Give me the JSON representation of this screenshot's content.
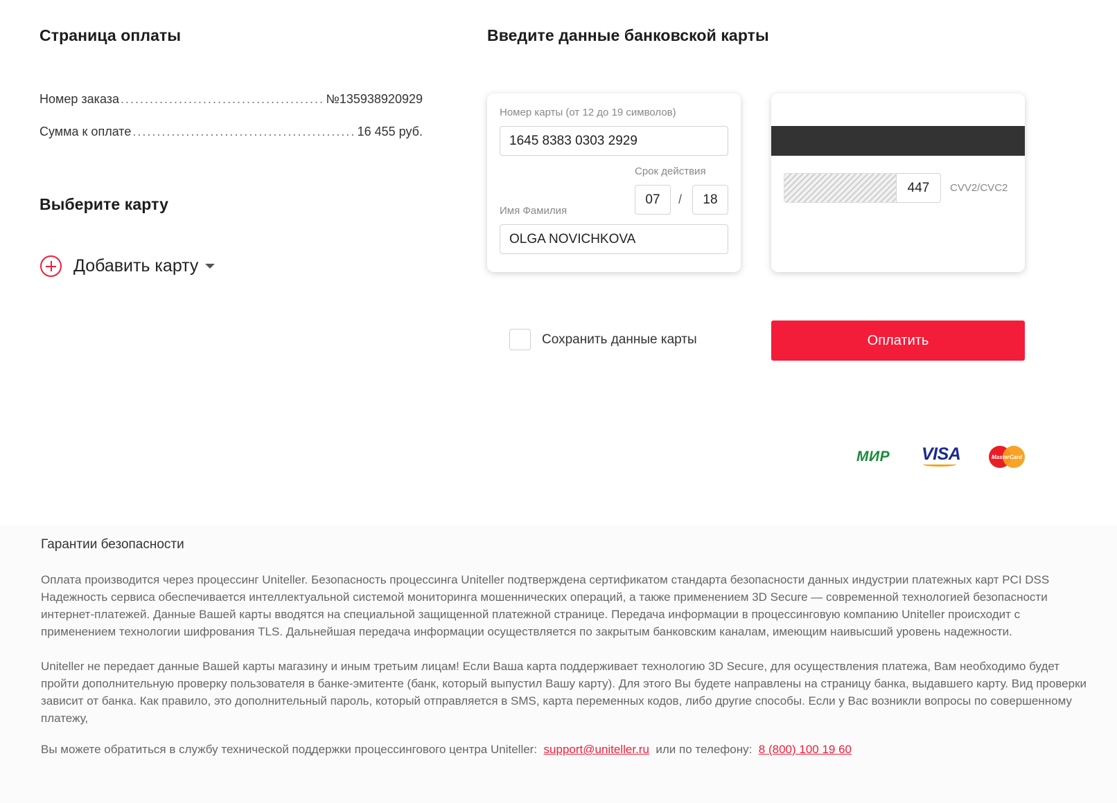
{
  "page_title": "Страница оплаты",
  "card_section_title": "Введите данные банковской карты",
  "order": {
    "number_label": "Номер заказа",
    "number_value": "№135938920929",
    "sum_label": "Сумма к оплате",
    "sum_value": "16 455 руб."
  },
  "choose_card_title": "Выберите карту",
  "add_card_label": "Добавить карту",
  "card_form": {
    "number_label": "Номер карты (от 12 до 19 символов)",
    "number_value": "1645 8383 0303 2929",
    "expiry_label": "Срок действия",
    "expiry_month": "07",
    "expiry_separator": "/",
    "expiry_year": "18",
    "name_label": "Имя Фамилия",
    "name_value": "OLGA NOVICHKOVA",
    "cvv_value": "447",
    "cvv_label": "CVV2/CVC2"
  },
  "save_card_label": "Сохранить данные карты",
  "pay_button_label": "Оплатить",
  "logos": {
    "mir": "МИР",
    "visa": "VISA",
    "mastercard": "MasterCard"
  },
  "security": {
    "title": "Гарантии безопасности",
    "paragraph1": "Оплата производится через процессинг Uniteller. Безопасность процессинга Uniteller подтверждена сертификатом стандарта безопасности данных индустрии платежных карт PCI DSS Надежность сервиса обеспечивается интеллектуальной системой мониторинга мошеннических операций, а также применением 3D Secure — современной технологией безопасности интернет-платежей. Данные Вашей карты вводятся на специальной защищенной платежной странице. Передача информации в процессинговую компанию Uniteller происходит с применением технологии шифрования TLS. Дальнейшая передача информации осуществляется по закрытым банковским каналам, имеющим наивысший уровень надежности.",
    "paragraph2": "Uniteller не передает данные Вашей карты магазину и иным третьим лицам! Если Ваша карта поддерживает технологию 3D Secure, для осуществления платежа, Вам необходимо будет пройти дополнительную проверку пользователя в банке-эмитенте (банк, который выпустил Вашу карту). Для этого Вы будете направлены на страницу банка, выдавшего карту. Вид проверки зависит от банка. Как правило, это дополнительный пароль, который отправляется в SMS, карта переменных кодов, либо другие способы. Если у Вас возникли вопросы по совершенному платежу,",
    "support_text": "Вы можете обратиться в службу технической поддержки процессингового центра Uniteller:",
    "support_email": "support@uniteller.ru",
    "or_phone_text": "или по телефону:",
    "support_phone": "8 (800) 100 19 60"
  },
  "colors": {
    "accent": "#f31d3a",
    "mir_green": "#1b8a3a",
    "visa_blue": "#1a2b8f"
  }
}
